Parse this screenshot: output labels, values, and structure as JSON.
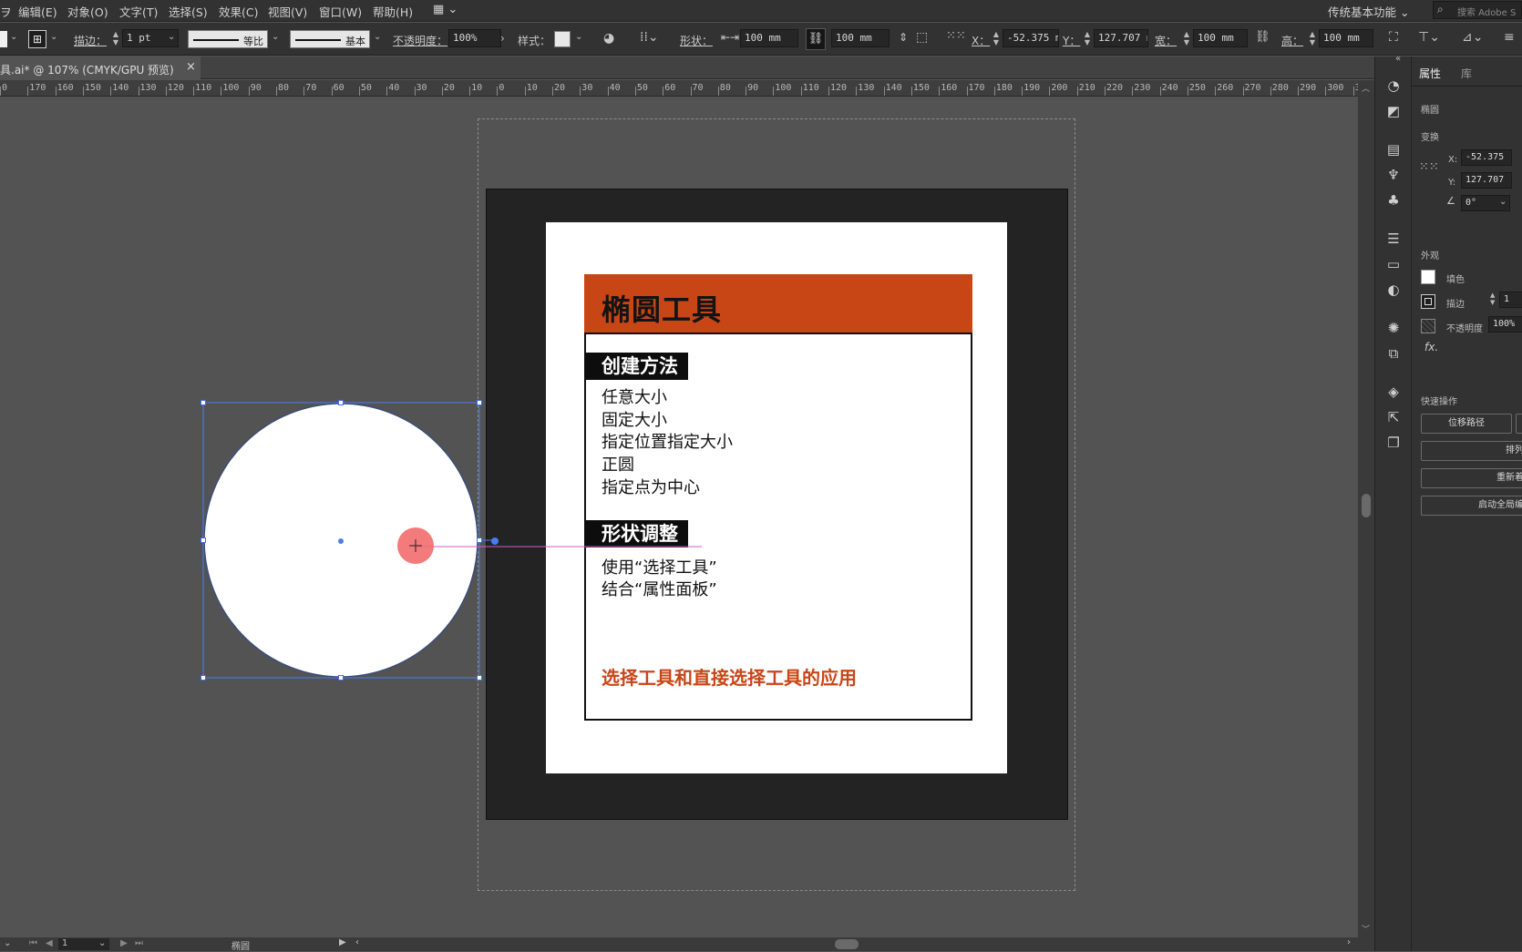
{
  "menu": [
    "编辑(E)",
    "对象(O)",
    "文字(T)",
    "选择(S)",
    "效果(C)",
    "视图(V)",
    "窗口(W)",
    "帮助(H)"
  ],
  "menu_prefix": "ヲ",
  "workspace": "传统基本功能",
  "search_placeholder": "搜索 Adobe S",
  "control": {
    "stroke_label": "描边：",
    "stroke_weight": "1 pt",
    "profile_uniform": "等比",
    "brush_basic": "基本",
    "opacity_label": "不透明度：",
    "opacity": "100%",
    "style_label": "样式：",
    "shape_label": "形状：",
    "shape_w": "100 mm",
    "shape_h": "100 mm",
    "x_label": "X：",
    "x": "-52.375 m",
    "y_label": "Y：",
    "y": "127.707 m",
    "w_label": "宽：",
    "w": "100 mm",
    "h_label": "高：",
    "h": "100 mm"
  },
  "doc_tab": "具.ai* @ 107% (CMYK/GPU 预览)",
  "doc_close": "×",
  "ruler": [
    "0",
    "170",
    "160",
    "150",
    "140",
    "130",
    "120",
    "110",
    "100",
    "90",
    "80",
    "70",
    "60",
    "50",
    "40",
    "30",
    "20",
    "10",
    "0",
    "10",
    "20",
    "30",
    "40",
    "50",
    "60",
    "70",
    "80",
    "90",
    "100",
    "110",
    "120",
    "130",
    "140",
    "150",
    "160",
    "170",
    "180",
    "190",
    "200",
    "210",
    "220",
    "230",
    "240",
    "250",
    "260",
    "270",
    "280",
    "290",
    "300",
    "31"
  ],
  "artboard": {
    "title": "椭圆工具",
    "section1": "创建方法",
    "items1": [
      "任意大小",
      "固定大小",
      "指定位置指定大小",
      "正圆",
      "指定点为中心"
    ],
    "section2": "形状调整",
    "items2": [
      "使用“选择工具”",
      "结合“属性面板”"
    ],
    "footer": "选择工具和直接选择工具的应用",
    "accent_color": "#c84516"
  },
  "status": {
    "page": "1",
    "tool": "椭圆"
  },
  "panel": {
    "tab_properties": "属性",
    "tab_library": "库",
    "object_type": "椭圆",
    "transform": "变换",
    "x_label": "X:",
    "x": "-52.375",
    "y_label": "Y:",
    "y": "127.707",
    "angle": "0°",
    "appearance": "外观",
    "fill": "填色",
    "stroke": "描边",
    "stroke_val": "1",
    "opacity": "不透明度",
    "opacity_val": "100%",
    "fx": "fx.",
    "quick_actions": "快速操作",
    "btn_offset": "位移路径",
    "btn_arrange": "排列",
    "btn_recolor": "重新着",
    "btn_global": "启动全局编"
  }
}
